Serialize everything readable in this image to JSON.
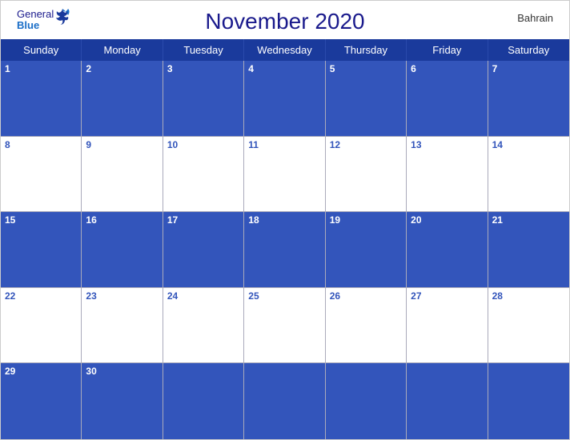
{
  "header": {
    "title": "November 2020",
    "country": "Bahrain",
    "logo_general": "General",
    "logo_blue": "Blue"
  },
  "days": [
    "Sunday",
    "Monday",
    "Tuesday",
    "Wednesday",
    "Thursday",
    "Friday",
    "Saturday"
  ],
  "weeks": [
    [
      {
        "date": "1",
        "bg": "blue"
      },
      {
        "date": "2",
        "bg": "blue"
      },
      {
        "date": "3",
        "bg": "blue"
      },
      {
        "date": "4",
        "bg": "blue"
      },
      {
        "date": "5",
        "bg": "blue"
      },
      {
        "date": "6",
        "bg": "blue"
      },
      {
        "date": "7",
        "bg": "blue"
      }
    ],
    [
      {
        "date": "8",
        "bg": "white"
      },
      {
        "date": "9",
        "bg": "white"
      },
      {
        "date": "10",
        "bg": "white"
      },
      {
        "date": "11",
        "bg": "white"
      },
      {
        "date": "12",
        "bg": "white"
      },
      {
        "date": "13",
        "bg": "white"
      },
      {
        "date": "14",
        "bg": "white"
      }
    ],
    [
      {
        "date": "15",
        "bg": "blue"
      },
      {
        "date": "16",
        "bg": "blue"
      },
      {
        "date": "17",
        "bg": "blue"
      },
      {
        "date": "18",
        "bg": "blue"
      },
      {
        "date": "19",
        "bg": "blue"
      },
      {
        "date": "20",
        "bg": "blue"
      },
      {
        "date": "21",
        "bg": "blue"
      }
    ],
    [
      {
        "date": "22",
        "bg": "white"
      },
      {
        "date": "23",
        "bg": "white"
      },
      {
        "date": "24",
        "bg": "white"
      },
      {
        "date": "25",
        "bg": "white"
      },
      {
        "date": "26",
        "bg": "white"
      },
      {
        "date": "27",
        "bg": "white"
      },
      {
        "date": "28",
        "bg": "white"
      }
    ],
    [
      {
        "date": "29",
        "bg": "blue"
      },
      {
        "date": "30",
        "bg": "blue"
      },
      {
        "date": "",
        "bg": "blue"
      },
      {
        "date": "",
        "bg": "blue"
      },
      {
        "date": "",
        "bg": "blue"
      },
      {
        "date": "",
        "bg": "blue"
      },
      {
        "date": "",
        "bg": "blue"
      }
    ]
  ],
  "colors": {
    "blue_header": "#1a3a9c",
    "blue_row": "#3355bb",
    "white_row": "#ffffff",
    "title_color": "#1a1a8c",
    "date_blue": "#3355bb"
  }
}
